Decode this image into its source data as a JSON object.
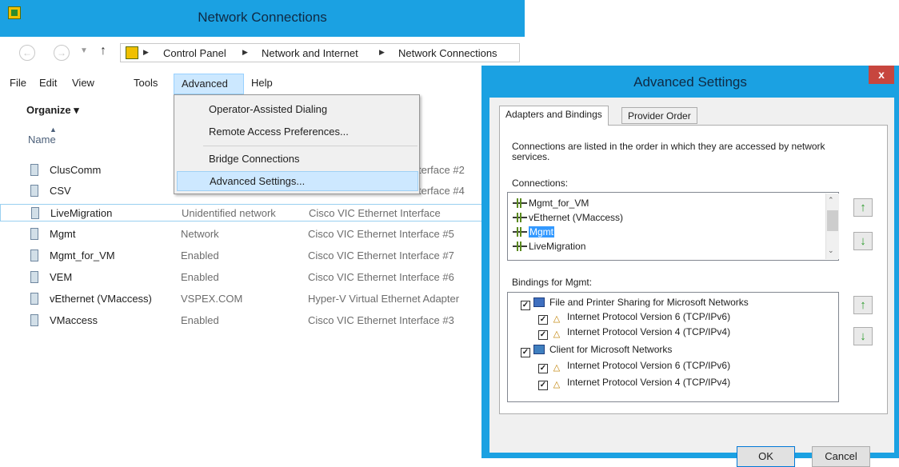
{
  "network_connections": {
    "title": "Network Connections",
    "breadcrumb": [
      "Control Panel",
      "Network and Internet",
      "Network Connections"
    ],
    "menu": [
      "File",
      "Edit",
      "View",
      "Tools",
      "Advanced",
      "Help"
    ],
    "toolbar": {
      "organize": "Organize ▾"
    },
    "column_name": "Name",
    "advanced_menu": {
      "items": [
        "Operator-Assisted Dialing",
        "Remote Access Preferences...",
        "Bridge Connections",
        "Advanced Settings..."
      ]
    },
    "connections": [
      {
        "name": "ClusComm",
        "status": "",
        "device": "terface #2"
      },
      {
        "name": "CSV",
        "status": "",
        "device": "terface #4"
      },
      {
        "name": "LiveMigration",
        "status": "Unidentified network",
        "device": "Cisco VIC Ethernet Interface"
      },
      {
        "name": "Mgmt",
        "status": "Network",
        "device": "Cisco VIC Ethernet Interface #5"
      },
      {
        "name": "Mgmt_for_VM",
        "status": "Enabled",
        "device": "Cisco VIC Ethernet Interface #7"
      },
      {
        "name": "VEM",
        "status": "Enabled",
        "device": "Cisco VIC Ethernet Interface #6"
      },
      {
        "name": "vEthernet (VMaccess)",
        "status": "VSPEX.COM",
        "device": "Hyper-V Virtual Ethernet Adapter"
      },
      {
        "name": "VMaccess",
        "status": "Enabled",
        "device": "Cisco VIC Ethernet Interface #3"
      }
    ]
  },
  "advanced_settings": {
    "title": "Advanced Settings",
    "close": "x",
    "tabs": [
      "Adapters and Bindings",
      "Provider Order"
    ],
    "description": "Connections are listed in the order in which they are accessed by network services.",
    "connections_label": "Connections:",
    "connections": [
      "Mgmt_for_VM",
      "vEthernet (VMaccess)",
      "Mgmt",
      "LiveMigration"
    ],
    "selected_connection": "Mgmt",
    "bindings_label": "Bindings for Mgmt:",
    "bindings": [
      {
        "label": "File and Printer Sharing for Microsoft Networks",
        "checked": true,
        "icon": "share-icon"
      },
      {
        "label": "Internet Protocol Version 6 (TCP/IPv6)",
        "checked": true,
        "icon": "protocol-icon"
      },
      {
        "label": "Internet Protocol Version 4 (TCP/IPv4)",
        "checked": true,
        "icon": "protocol-icon"
      },
      {
        "label": "Client for Microsoft Networks",
        "checked": true,
        "icon": "client-icon"
      },
      {
        "label": "Internet Protocol Version 6 (TCP/IPv6)",
        "checked": true,
        "icon": "protocol-icon"
      },
      {
        "label": "Internet Protocol Version 4 (TCP/IPv4)",
        "checked": true,
        "icon": "protocol-icon"
      }
    ],
    "ok": "OK",
    "cancel": "Cancel"
  },
  "colors": {
    "title_bar": "#1ba1e2",
    "selection": "#3399ff",
    "menu_highlight": "#cce8ff",
    "close_button": "#c7463e"
  }
}
